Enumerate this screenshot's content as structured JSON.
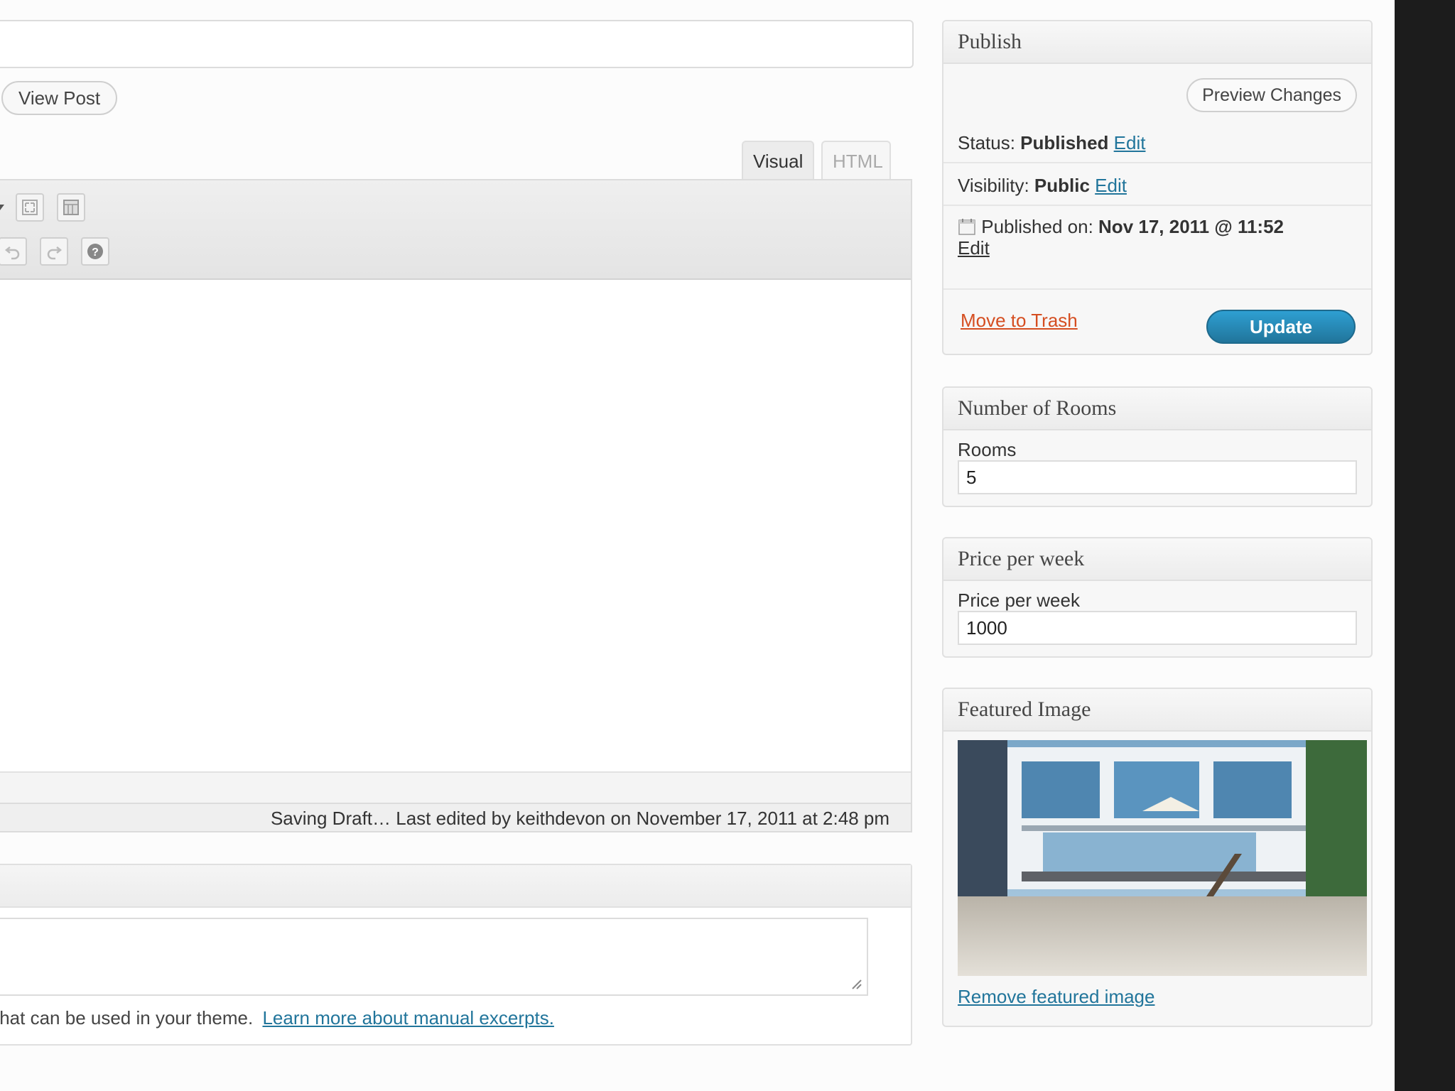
{
  "post": {
    "view_post_label": "View Post"
  },
  "editor": {
    "tabs": [
      {
        "label": "Visual",
        "active": true
      },
      {
        "label": "HTML",
        "active": false
      }
    ],
    "toolbar_icons": [
      "fullscreen-icon",
      "kitchen-sink-icon",
      "undo-icon",
      "redo-icon",
      "help-icon"
    ],
    "status_text": "Saving Draft… Last edited by keithdevon on November 17, 2011 at 2:48 pm"
  },
  "excerpt": {
    "note_text": "that can be used in your theme.",
    "note_link": "Learn more about manual excerpts."
  },
  "publish": {
    "title": "Publish",
    "preview_label": "Preview Changes",
    "status_label": "Status:",
    "status_value": "Published",
    "visibility_label": "Visibility:",
    "visibility_value": "Public",
    "published_on_label": "Published on:",
    "published_on_value": "Nov 17, 2011 @ 11:52",
    "edit_label": "Edit",
    "trash_label": "Move to Trash",
    "update_label": "Update"
  },
  "rooms_box": {
    "title": "Number of Rooms",
    "field_label": "Rooms",
    "field_value": "5"
  },
  "price_box": {
    "title": "Price per week",
    "field_label": "Price per week",
    "field_value": "1000"
  },
  "featured_box": {
    "title": "Featured Image",
    "remove_label": "Remove featured image"
  },
  "colors": {
    "link": "#21759b",
    "trash": "#d54e21",
    "update_button": "#21759b"
  }
}
